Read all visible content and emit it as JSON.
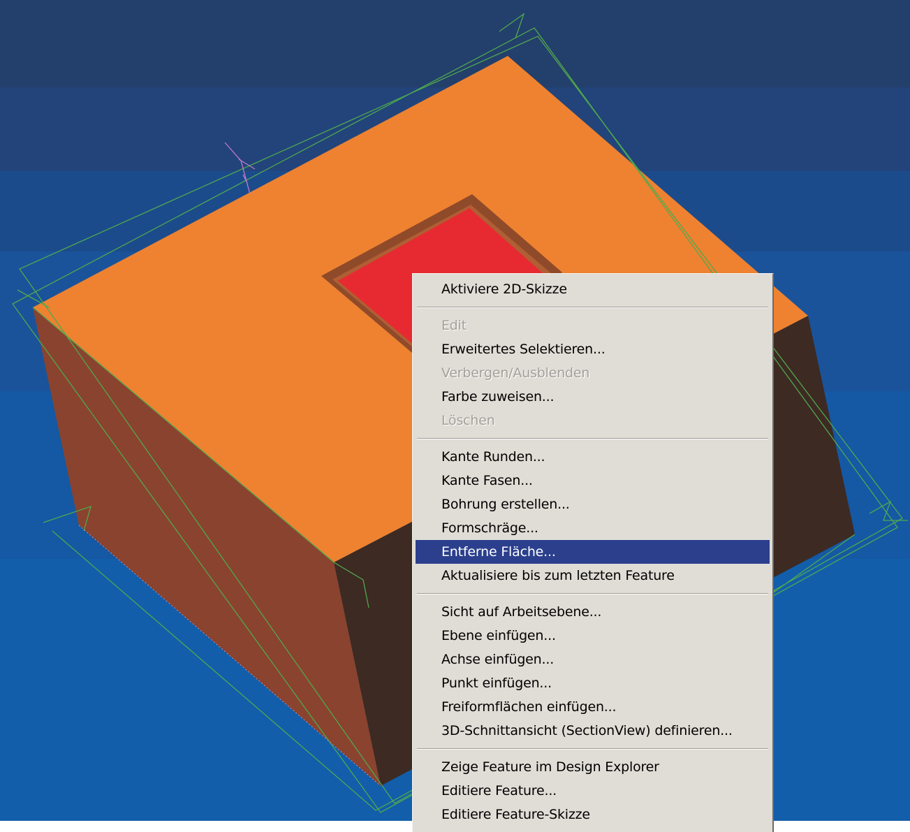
{
  "colors": {
    "model_top": "#ee8230",
    "model_front": "#8a432e",
    "model_right": "#3d2a22",
    "pocket_floor": "#e72a31",
    "wireframe": "#4fa84f",
    "menu_bg": "#e0ddd6",
    "menu_highlight": "#2b3f8d"
  },
  "context_menu": {
    "groups": [
      {
        "items": [
          {
            "label": "Aktiviere 2D-Skizze",
            "enabled": true
          }
        ]
      },
      {
        "items": [
          {
            "label": "Edit",
            "enabled": false
          },
          {
            "label": "Erweitertes Selektieren...",
            "enabled": true
          },
          {
            "label": "Verbergen/Ausblenden",
            "enabled": false
          },
          {
            "label": "Farbe zuweisen...",
            "enabled": true
          },
          {
            "label": "Löschen",
            "enabled": false
          }
        ]
      },
      {
        "items": [
          {
            "label": "Kante Runden...",
            "enabled": true
          },
          {
            "label": "Kante Fasen...",
            "enabled": true
          },
          {
            "label": "Bohrung erstellen...",
            "enabled": true
          },
          {
            "label": "Formschräge...",
            "enabled": true
          },
          {
            "label": "Entferne Fläche...",
            "enabled": true,
            "highlighted": true
          },
          {
            "label": "Aktualisiere bis zum letzten Feature",
            "enabled": true
          }
        ]
      },
      {
        "items": [
          {
            "label": "Sicht auf Arbeitsebene...",
            "enabled": true
          },
          {
            "label": "Ebene einfügen...",
            "enabled": true
          },
          {
            "label": "Achse einfügen...",
            "enabled": true
          },
          {
            "label": "Punkt einfügen...",
            "enabled": true
          },
          {
            "label": "Freiformflächen einfügen...",
            "enabled": true
          },
          {
            "label": "3D-Schnittansicht (SectionView) definieren...",
            "enabled": true
          }
        ]
      },
      {
        "items": [
          {
            "label": "Zeige Feature im Design Explorer",
            "enabled": true
          },
          {
            "label": "Editiere Feature...",
            "enabled": true
          },
          {
            "label": "Editiere Feature-Skizze",
            "enabled": true
          }
        ]
      }
    ]
  }
}
